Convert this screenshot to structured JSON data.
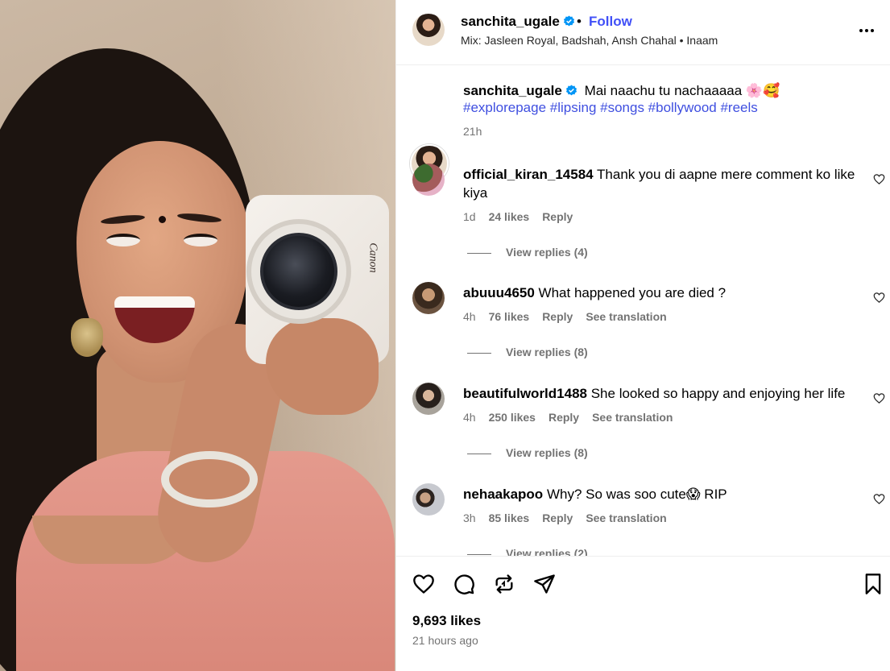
{
  "header": {
    "username": "sanchita_ugale",
    "dot": "•",
    "follow_label": "Follow",
    "audio": "Mix: Jasleen Royal, Badshah, Ansh Chahal • Inaam"
  },
  "caption": {
    "username": "sanchita_ugale",
    "text": "Mai naachu tu nachaaaaa 🌸🥰",
    "hashtags": "#explorepage #lipsing #songs #bollywood #reels",
    "time": "21h"
  },
  "comments": [
    {
      "username": "official_kiran_14584",
      "text": "Thank you di aapne mere comment ko like kiya",
      "time": "1d",
      "likes": "24 likes",
      "reply": "Reply",
      "translation": "",
      "view_replies": "View replies (4)"
    },
    {
      "username": "abuuu4650",
      "text": "What happened you are died ?",
      "time": "4h",
      "likes": "76 likes",
      "reply": "Reply",
      "translation": "See translation",
      "view_replies": "View replies (8)"
    },
    {
      "username": "beautifulworld1488",
      "text": "She looked so happy and enjoying her life",
      "time": "4h",
      "likes": "250 likes",
      "reply": "Reply",
      "translation": "See translation",
      "view_replies": "View replies (8)"
    },
    {
      "username": "nehaakapoo",
      "text": "Why? So was soo cute😱 RIP",
      "time": "3h",
      "likes": "85 likes",
      "reply": "Reply",
      "translation": "See translation",
      "view_replies": "View replies (2)"
    }
  ],
  "footer": {
    "likes": "9,693 likes",
    "posted": "21 hours ago"
  },
  "media": {
    "camera_brand": "Canon"
  },
  "colors": {
    "follow": "#4150f7",
    "hashtag": "#3f4fe0",
    "secondary_text": "#737373",
    "verified": "#0095f6"
  },
  "icons": [
    "verified-badge-icon",
    "more-options-icon",
    "heart-icon",
    "comment-icon",
    "repost-icon",
    "share-icon",
    "bookmark-icon"
  ]
}
